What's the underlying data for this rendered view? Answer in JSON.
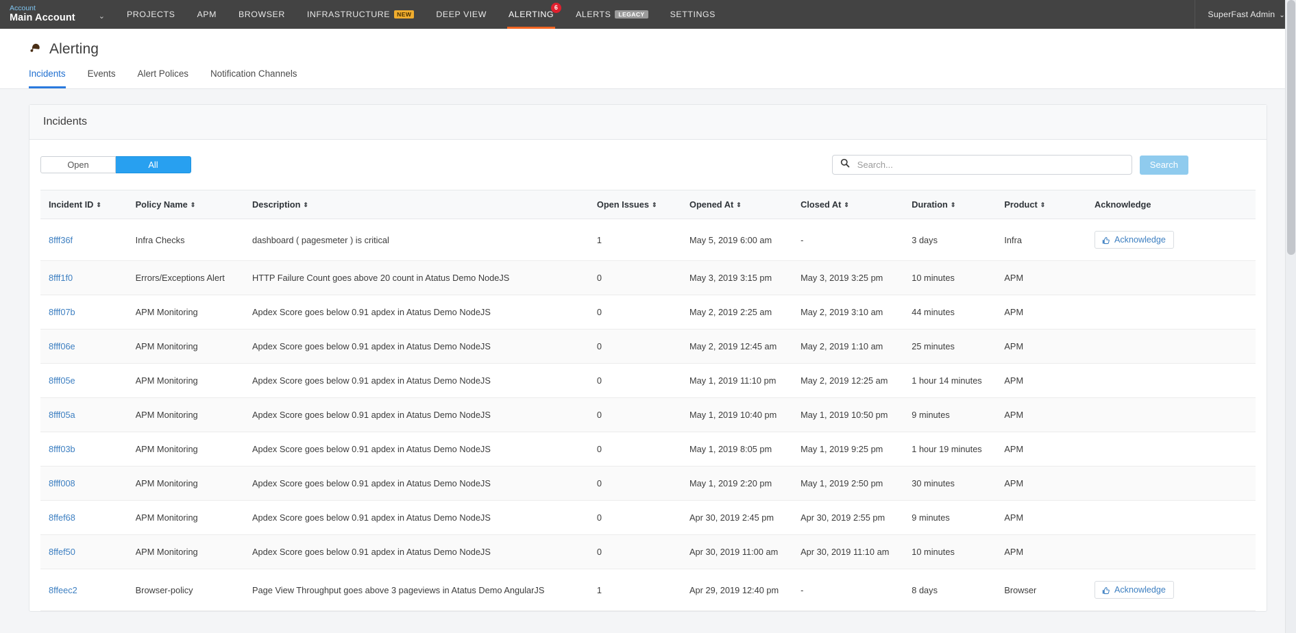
{
  "topnav": {
    "account_label": "Account",
    "account_name": "Main Account",
    "account_caret": "⌄",
    "items": [
      {
        "label": "PROJECTS",
        "badge": null,
        "badge_type": null,
        "count": null,
        "active": false
      },
      {
        "label": "APM",
        "badge": null,
        "badge_type": null,
        "count": null,
        "active": false
      },
      {
        "label": "BROWSER",
        "badge": null,
        "badge_type": null,
        "count": null,
        "active": false
      },
      {
        "label": "INFRASTRUCTURE",
        "badge": "NEW",
        "badge_type": "new",
        "count": null,
        "active": false
      },
      {
        "label": "DEEP VIEW",
        "badge": null,
        "badge_type": null,
        "count": null,
        "active": false
      },
      {
        "label": "ALERTING",
        "badge": null,
        "badge_type": null,
        "count": "6",
        "active": true
      },
      {
        "label": "ALERTS",
        "badge": "LEGACY",
        "badge_type": "legacy",
        "count": null,
        "active": false
      },
      {
        "label": "SETTINGS",
        "badge": null,
        "badge_type": null,
        "count": null,
        "active": false
      }
    ],
    "user": "SuperFast Admin",
    "user_caret": "⌄"
  },
  "page": {
    "title": "Alerting",
    "tabs": [
      {
        "label": "Incidents",
        "active": true
      },
      {
        "label": "Events",
        "active": false
      },
      {
        "label": "Alert Polices",
        "active": false
      },
      {
        "label": "Notification Channels",
        "active": false
      }
    ]
  },
  "card": {
    "title": "Incidents",
    "toggle": {
      "open_label": "Open",
      "all_label": "All",
      "selected": "All"
    },
    "search": {
      "placeholder": "Search...",
      "value": "",
      "button_label": "Search"
    }
  },
  "table": {
    "columns": [
      {
        "label": "Incident ID",
        "sortable": true
      },
      {
        "label": "Policy Name",
        "sortable": true
      },
      {
        "label": "Description",
        "sortable": true
      },
      {
        "label": "Open Issues",
        "sortable": true
      },
      {
        "label": "Opened At",
        "sortable": true
      },
      {
        "label": "Closed At",
        "sortable": true
      },
      {
        "label": "Duration",
        "sortable": true
      },
      {
        "label": "Product",
        "sortable": true
      },
      {
        "label": "Acknowledge",
        "sortable": false
      }
    ],
    "sort_glyph": "⇕",
    "acknowledge_label": "Acknowledge",
    "rows": [
      {
        "incident_id": "8fff36f",
        "policy_name": "Infra Checks",
        "description": "dashboard ( pagesmeter ) is critical",
        "open_issues": "1",
        "opened_at": "May 5, 2019 6:00 am",
        "closed_at": "-",
        "duration": "3 days",
        "product": "Infra",
        "acknowledge": true
      },
      {
        "incident_id": "8fff1f0",
        "policy_name": "Errors/Exceptions Alert",
        "description": "HTTP Failure Count goes above 20 count in Atatus Demo NodeJS",
        "open_issues": "0",
        "opened_at": "May 3, 2019 3:15 pm",
        "closed_at": "May 3, 2019 3:25 pm",
        "duration": "10 minutes",
        "product": "APM",
        "acknowledge": false
      },
      {
        "incident_id": "8fff07b",
        "policy_name": "APM Monitoring",
        "description": "Apdex Score goes below 0.91 apdex in Atatus Demo NodeJS",
        "open_issues": "0",
        "opened_at": "May 2, 2019 2:25 am",
        "closed_at": "May 2, 2019 3:10 am",
        "duration": "44 minutes",
        "product": "APM",
        "acknowledge": false
      },
      {
        "incident_id": "8fff06e",
        "policy_name": "APM Monitoring",
        "description": "Apdex Score goes below 0.91 apdex in Atatus Demo NodeJS",
        "open_issues": "0",
        "opened_at": "May 2, 2019 12:45 am",
        "closed_at": "May 2, 2019 1:10 am",
        "duration": "25 minutes",
        "product": "APM",
        "acknowledge": false
      },
      {
        "incident_id": "8fff05e",
        "policy_name": "APM Monitoring",
        "description": "Apdex Score goes below 0.91 apdex in Atatus Demo NodeJS",
        "open_issues": "0",
        "opened_at": "May 1, 2019 11:10 pm",
        "closed_at": "May 2, 2019 12:25 am",
        "duration": "1 hour 14 minutes",
        "product": "APM",
        "acknowledge": false
      },
      {
        "incident_id": "8fff05a",
        "policy_name": "APM Monitoring",
        "description": "Apdex Score goes below 0.91 apdex in Atatus Demo NodeJS",
        "open_issues": "0",
        "opened_at": "May 1, 2019 10:40 pm",
        "closed_at": "May 1, 2019 10:50 pm",
        "duration": "9 minutes",
        "product": "APM",
        "acknowledge": false
      },
      {
        "incident_id": "8fff03b",
        "policy_name": "APM Monitoring",
        "description": "Apdex Score goes below 0.91 apdex in Atatus Demo NodeJS",
        "open_issues": "0",
        "opened_at": "May 1, 2019 8:05 pm",
        "closed_at": "May 1, 2019 9:25 pm",
        "duration": "1 hour 19 minutes",
        "product": "APM",
        "acknowledge": false
      },
      {
        "incident_id": "8fff008",
        "policy_name": "APM Monitoring",
        "description": "Apdex Score goes below 0.91 apdex in Atatus Demo NodeJS",
        "open_issues": "0",
        "opened_at": "May 1, 2019 2:20 pm",
        "closed_at": "May 1, 2019 2:50 pm",
        "duration": "30 minutes",
        "product": "APM",
        "acknowledge": false
      },
      {
        "incident_id": "8ffef68",
        "policy_name": "APM Monitoring",
        "description": "Apdex Score goes below 0.91 apdex in Atatus Demo NodeJS",
        "open_issues": "0",
        "opened_at": "Apr 30, 2019 2:45 pm",
        "closed_at": "Apr 30, 2019 2:55 pm",
        "duration": "9 minutes",
        "product": "APM",
        "acknowledge": false
      },
      {
        "incident_id": "8ffef50",
        "policy_name": "APM Monitoring",
        "description": "Apdex Score goes below 0.91 apdex in Atatus Demo NodeJS",
        "open_issues": "0",
        "opened_at": "Apr 30, 2019 11:00 am",
        "closed_at": "Apr 30, 2019 11:10 am",
        "duration": "10 minutes",
        "product": "APM",
        "acknowledge": false
      },
      {
        "incident_id": "8ffeec2",
        "policy_name": "Browser-policy",
        "description": "Page View Throughput goes above 3 pageviews in Atatus Demo AngularJS",
        "open_issues": "1",
        "opened_at": "Apr 29, 2019 12:40 pm",
        "closed_at": "-",
        "duration": "8 days",
        "product": "Browser",
        "acknowledge": true
      }
    ]
  },
  "colors": {
    "nav_bg": "#434343",
    "active_underline": "#f26522",
    "accent_blue": "#28a0f0",
    "link_blue": "#3d7fc1",
    "badge_new": "#f0ad2e",
    "badge_count": "#e0202e",
    "badge_legacy": "#9b9b9b"
  }
}
